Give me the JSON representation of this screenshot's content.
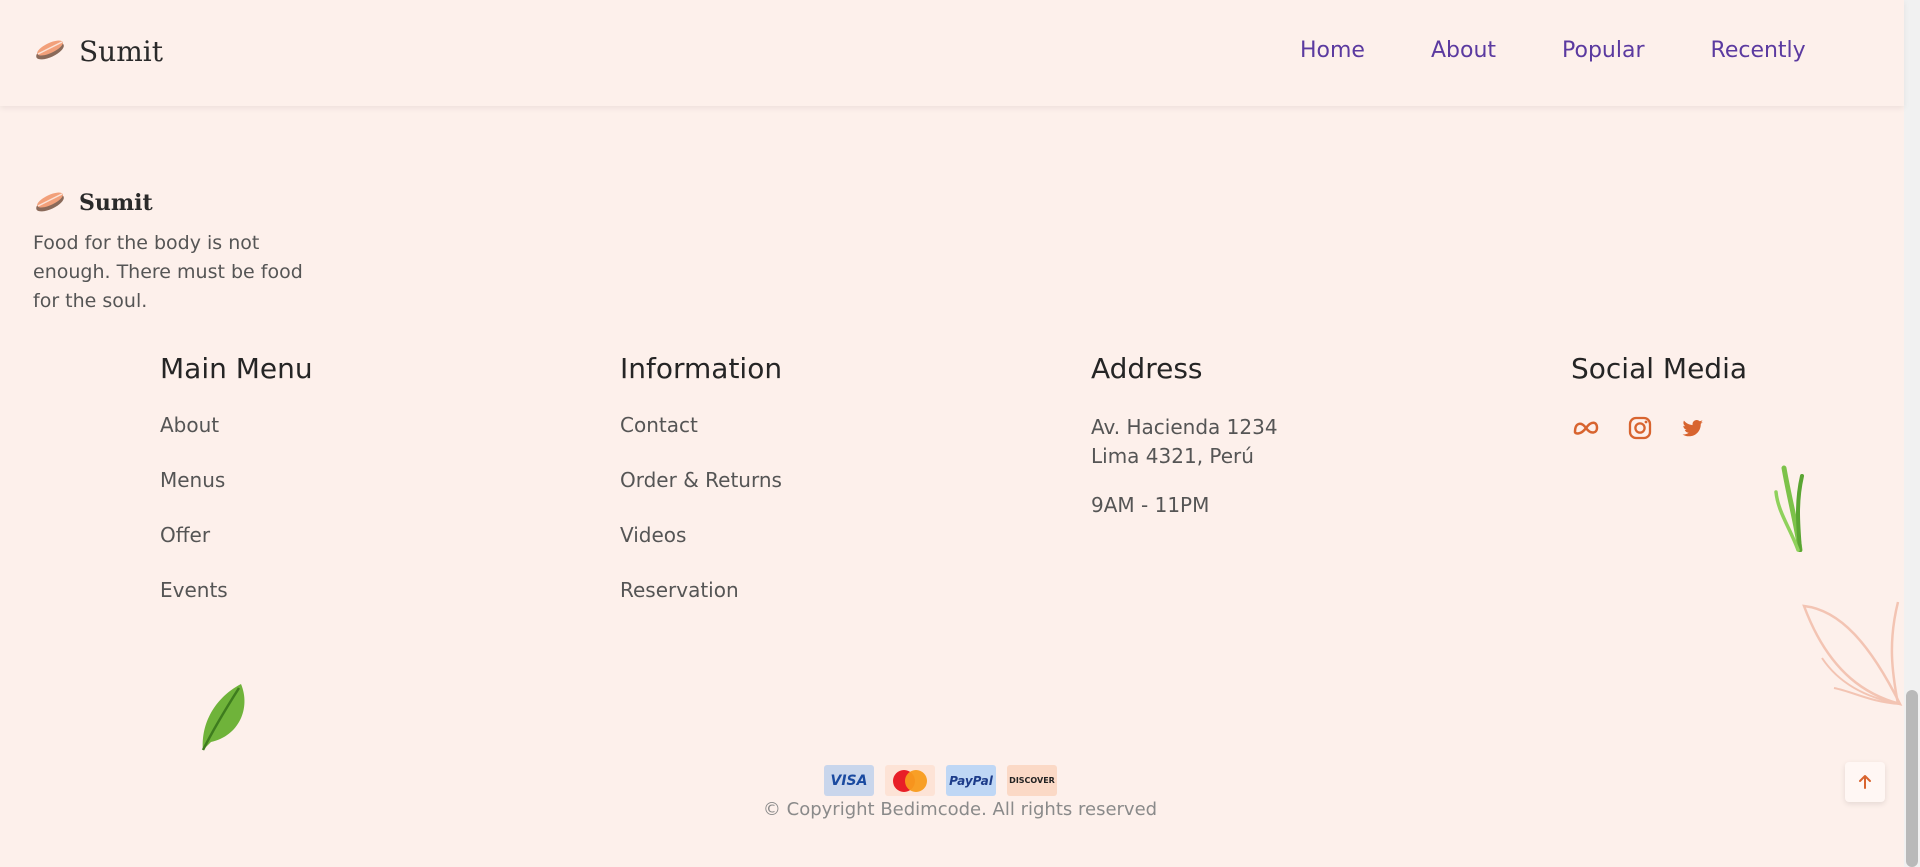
{
  "header": {
    "brand": "Sumit",
    "nav": [
      "Home",
      "About",
      "Popular",
      "Recently"
    ]
  },
  "footer": {
    "brand": "Sumit",
    "tagline": "Food for the body is not enough. There must be food for the soul.",
    "columns": {
      "main_menu": {
        "title": "Main Menu",
        "items": [
          "About",
          "Menus",
          "Offer",
          "Events"
        ]
      },
      "information": {
        "title": "Information",
        "items": [
          "Contact",
          "Order & Returns",
          "Videos",
          "Reservation"
        ]
      },
      "address": {
        "title": "Address",
        "line1": "Av. Hacienda 1234",
        "line2": "Lima 4321, Perú",
        "hours": "9AM - 11PM"
      },
      "social": {
        "title": "Social Media",
        "icons": [
          "meta-icon",
          "instagram-icon",
          "twitter-icon"
        ]
      }
    },
    "payments": {
      "visa": "VISA",
      "paypal": "PayPal",
      "discover": "DISCOVER"
    },
    "copyright": "© Copyright Bedimcode. All rights reserved"
  },
  "colors": {
    "background": "#fdf0eb",
    "nav_link": "#5b3aa0",
    "accent": "#d8642f"
  }
}
